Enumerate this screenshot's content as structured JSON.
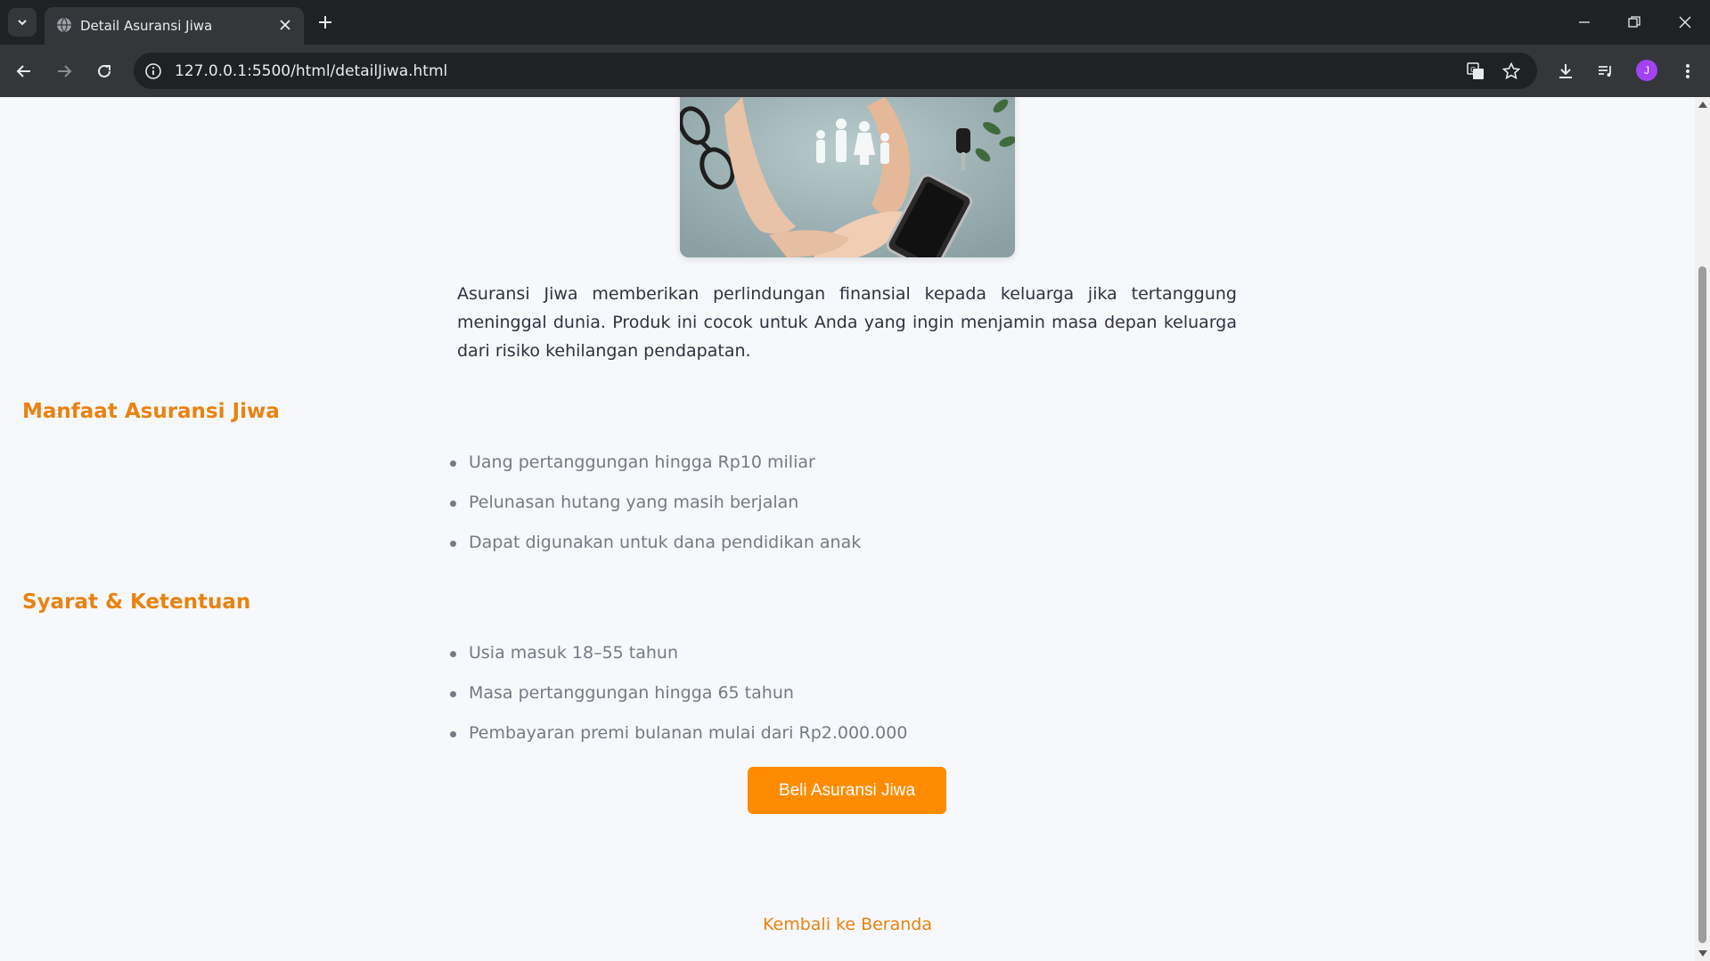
{
  "browser": {
    "tab_title": "Detail Asuransi Jiwa",
    "url": "127.0.0.1:5500/html/detailJiwa.html",
    "avatar_initial": "J"
  },
  "page": {
    "intro": "Asuransi Jiwa memberikan perlindungan finansial kepada keluarga jika tertanggung meninggal dunia. Produk ini cocok untuk Anda yang ingin menjamin masa depan keluarga dari risiko kehilangan pendapatan.",
    "benefits_title": "Manfaat Asuransi Jiwa",
    "benefits": [
      "Uang pertanggungan hingga Rp10 miliar",
      "Pelunasan hutang yang masih berjalan",
      "Dapat digunakan untuk dana pendidikan anak"
    ],
    "terms_title": "Syarat & Ketentuan",
    "terms": [
      "Usia masuk 18–55 tahun",
      "Masa pertanggungan hingga 65 tahun",
      "Pembayaran premi bulanan mulai dari Rp2.000.000"
    ],
    "buy_button": "Beli Asuransi Jiwa",
    "back_link": "Kembali ke Beranda"
  },
  "colors": {
    "accent": "#ea8210",
    "button": "#ff8c00",
    "page_bg": "#f7f8fb"
  }
}
